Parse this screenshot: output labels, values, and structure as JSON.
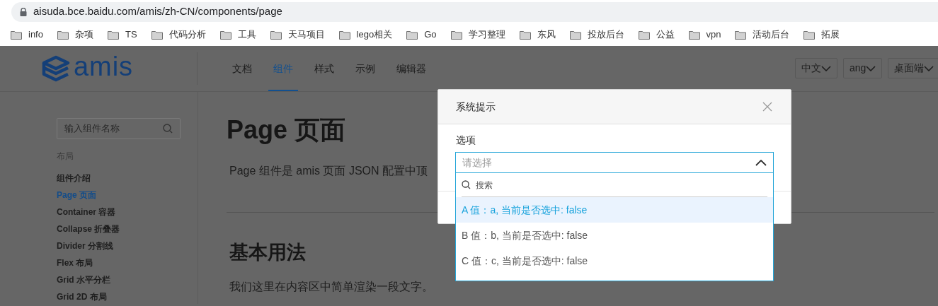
{
  "browser": {
    "url": "aisuda.bce.baidu.com/amis/zh-CN/components/page",
    "bookmarks": [
      "info",
      "杂项",
      "TS",
      "代码分析",
      "工具",
      "天马项目",
      "lego相关",
      "Go",
      "学习整理",
      "东风",
      "投放后台",
      "公益",
      "vpn",
      "活动后台",
      "拓展"
    ]
  },
  "header": {
    "logo": "amis",
    "nav": [
      {
        "label": "文档",
        "selected": false
      },
      {
        "label": "组件",
        "selected": true
      },
      {
        "label": "样式",
        "selected": false
      },
      {
        "label": "示例",
        "selected": false
      },
      {
        "label": "编辑器",
        "selected": false
      }
    ],
    "selectors": [
      "中文",
      "ang",
      "桌面端"
    ]
  },
  "sidebar": {
    "search_placeholder": "输入组件名称",
    "section": "布局",
    "items": [
      {
        "label": "组件介绍",
        "selected": false
      },
      {
        "label": "Page 页面",
        "selected": true
      },
      {
        "label": "Container 容器",
        "selected": false
      },
      {
        "label": "Collapse 折叠器",
        "selected": false
      },
      {
        "label": "Divider 分割线",
        "selected": false
      },
      {
        "label": "Flex 布局",
        "selected": false
      },
      {
        "label": "Grid 水平分栏",
        "selected": false
      },
      {
        "label": "Grid 2D 布局",
        "selected": false
      }
    ]
  },
  "content": {
    "title": "Page 页面",
    "intro": "Page 组件是 amis 页面 JSON 配置中顶",
    "heading": "基本用法",
    "text": "我们这里在内容区中简单渲染一段文字。"
  },
  "dialog": {
    "title": "系统提示",
    "field_label": "选项",
    "select": {
      "placeholder": "请选择",
      "expanded": true,
      "search_placeholder": "搜索",
      "options": [
        {
          "label": "A 值：a, 当前是否选中: false",
          "highlighted": true
        },
        {
          "label": "B 值：b, 当前是否选中: false",
          "highlighted": false
        },
        {
          "label": "C 值：c, 当前是否选中: false",
          "highlighted": false
        }
      ]
    }
  }
}
